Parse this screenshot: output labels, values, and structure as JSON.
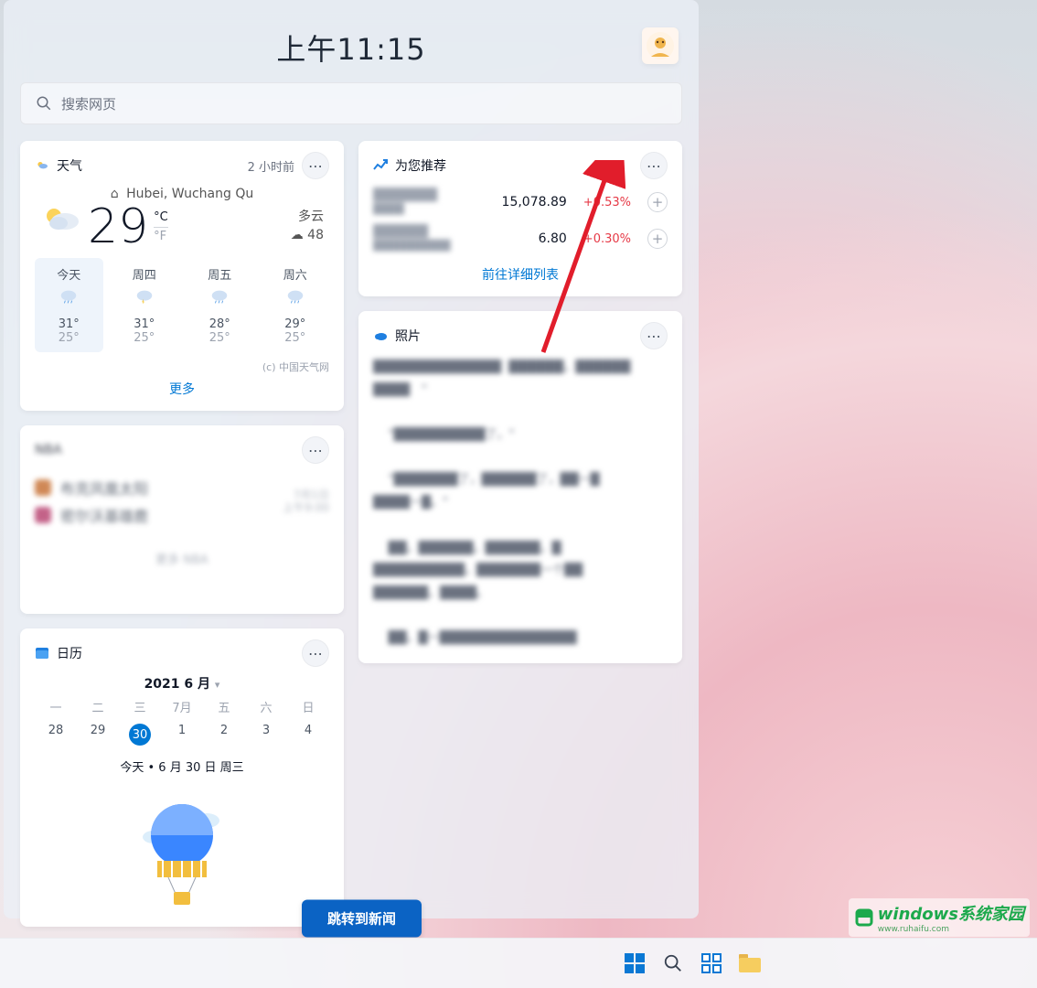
{
  "clock": "上午11:15",
  "search": {
    "placeholder": "搜索网页"
  },
  "weather": {
    "title": "天气",
    "updated": "2 小时前",
    "location": "Hubei, Wuchang Qu",
    "temp": "29",
    "unit_c": "°C",
    "unit_f": "°F",
    "condition": "多云",
    "extra": "☁ 48",
    "days": [
      {
        "label": "今天",
        "hi": "31°",
        "lo": "25°"
      },
      {
        "label": "周四",
        "hi": "31°",
        "lo": "25°"
      },
      {
        "label": "周五",
        "hi": "28°",
        "lo": "25°"
      },
      {
        "label": "周六",
        "hi": "29°",
        "lo": "25°"
      }
    ],
    "credit": "(c) 中国天气网",
    "more": "更多"
  },
  "recommended": {
    "title": "为您推荐",
    "rows": [
      {
        "value": "15,078.89",
        "change": "+0.53%"
      },
      {
        "value": "6.80",
        "change": "+0.30%"
      }
    ],
    "link": "前往详细列表"
  },
  "photos": {
    "title": "照片"
  },
  "nba": {
    "title": "NBA",
    "team1": "布克凤凰太阳",
    "team2": "密尔沃基雄鹿",
    "date": "7月1日",
    "time": "上午9:00",
    "foot": "更多 NBA"
  },
  "calendar": {
    "title": "日历",
    "month": "2021 6 月",
    "dow": [
      "一",
      "二",
      "三",
      "7月",
      "五",
      "六",
      "日"
    ],
    "days": [
      "28",
      "29",
      "30",
      "1",
      "2",
      "3",
      "4"
    ],
    "today_index": 2,
    "today_text": "今天 • 6 月 30 日 周三"
  },
  "news_button": "跳转到新闻",
  "watermark": {
    "brand": "windows系统家园",
    "url": "www.ruhaifu.com"
  }
}
